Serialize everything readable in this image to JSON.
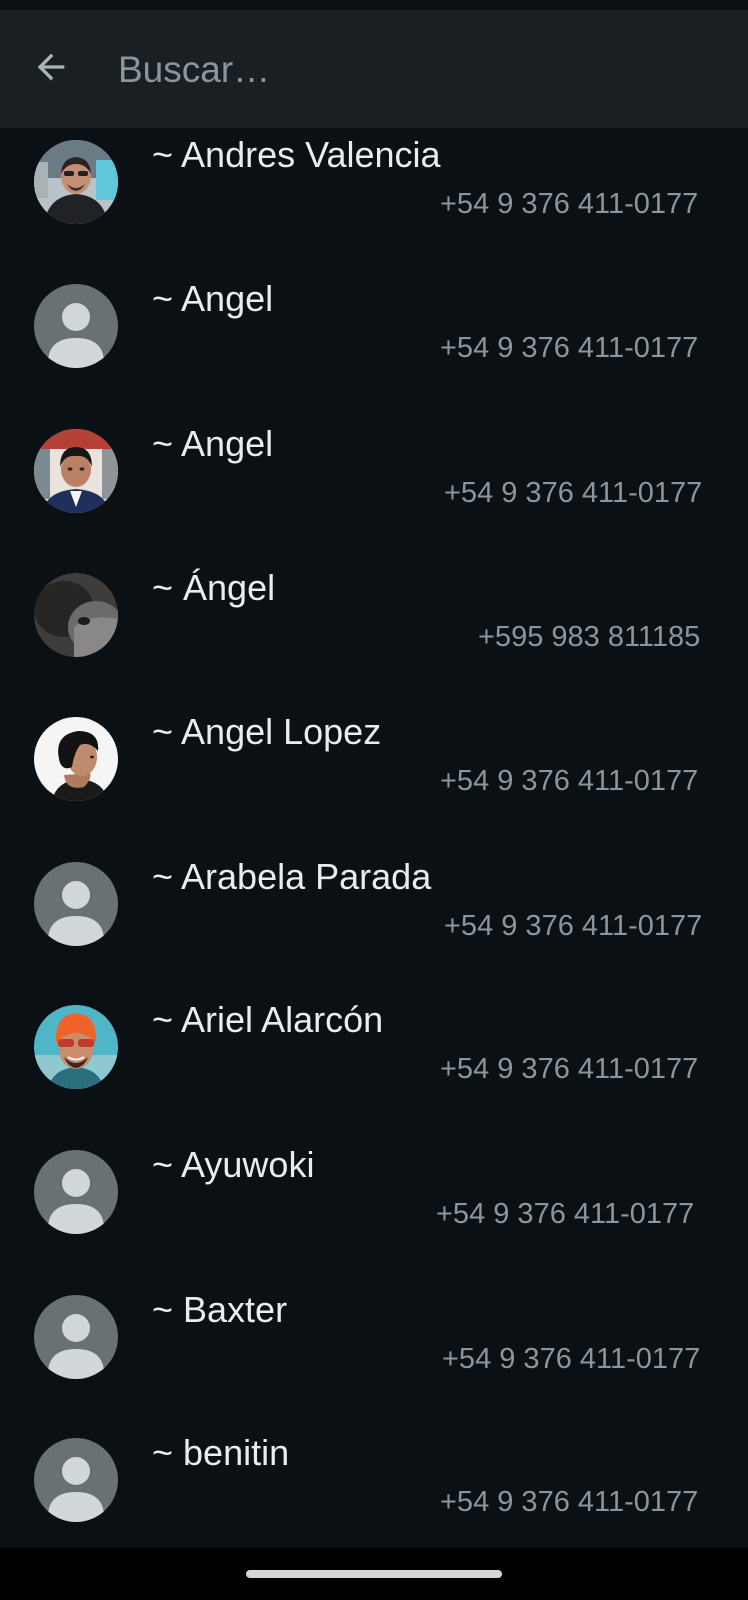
{
  "search": {
    "placeholder": "Buscar…",
    "back_icon": "arrow-left-icon"
  },
  "contacts": [
    {
      "name": "~ Andres Valencia",
      "phone": "+54 9 376 411-0177",
      "avatar": "photo"
    },
    {
      "name": "~ Angel",
      "phone": "+54 9 376 411-0177",
      "avatar": "default"
    },
    {
      "name": "~ Angel",
      "phone": "+54 9 376 411-0177",
      "avatar": "photo"
    },
    {
      "name": "~ Ángel",
      "phone": "+595 983 811185",
      "avatar": "photo"
    },
    {
      "name": "~ Angel Lopez",
      "phone": "+54 9 376 411-0177",
      "avatar": "photo"
    },
    {
      "name": "~ Arabela Parada",
      "phone": "+54 9 376 411-0177",
      "avatar": "default"
    },
    {
      "name": "~ Ariel Alarcón",
      "phone": "+54 9 376 411-0177",
      "avatar": "photo"
    },
    {
      "name": "~ Ayuwoki",
      "phone": "+54 9 376 411-0177",
      "avatar": "default"
    },
    {
      "name": "~ Baxter",
      "phone": "+54 9 376 411-0177",
      "avatar": "default"
    },
    {
      "name": "~ benitin",
      "phone": "+54 9 376 411-0177",
      "avatar": "default"
    }
  ],
  "colors": {
    "background": "#0b1014",
    "topbar": "#1a1f23",
    "primary_text": "#e9edef",
    "secondary_text": "#8b959b",
    "default_avatar_bg": "#6a7175",
    "default_avatar_fg": "#d1d7db"
  }
}
